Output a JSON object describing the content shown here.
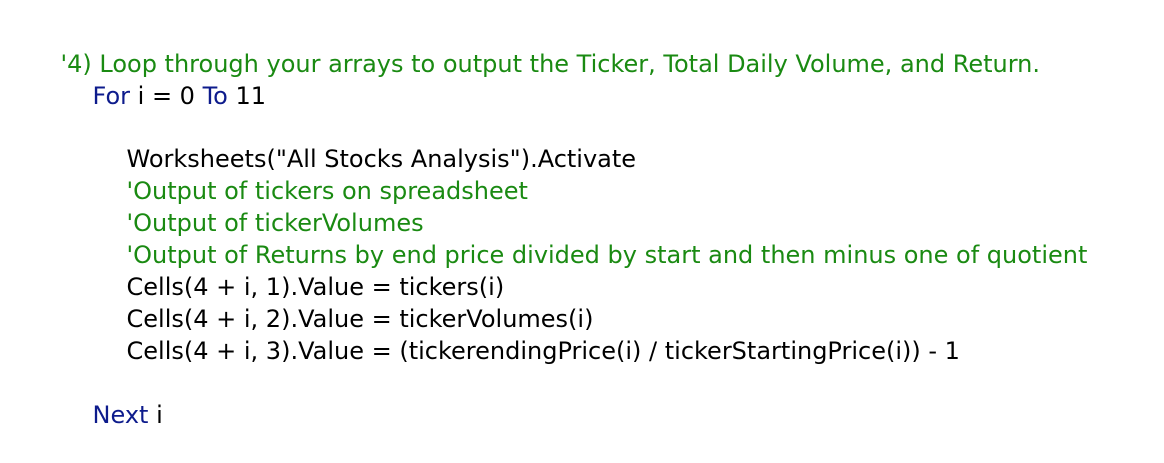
{
  "colors": {
    "comment": "#1a8a12",
    "keyword": "#0d1b8c",
    "text": "#000000",
    "background": "#ffffff"
  },
  "code": {
    "line1": {
      "comment": "'4) Loop through your arrays to output the Ticker, Total Daily Volume, and Return."
    },
    "line2": {
      "kw_for": "For",
      "mid": " i = 0 ",
      "kw_to": "To",
      "end": " 11"
    },
    "line3": {
      "text": "Worksheets(\"All Stocks Analysis\").Activate"
    },
    "line4": {
      "comment": "'Output of tickers on spreadsheet"
    },
    "line5": {
      "comment": "'Output of tickerVolumes"
    },
    "line6": {
      "comment": "'Output of Returns by end price divided by start and then minus one of quotient"
    },
    "line7": {
      "text": "Cells(4 + i, 1).Value = tickers(i)"
    },
    "line8": {
      "text": "Cells(4 + i, 2).Value = tickerVolumes(i)"
    },
    "line9": {
      "text": "Cells(4 + i, 3).Value = (tickerendingPrice(i) / tickerStartingPrice(i)) - 1"
    },
    "line10": {
      "kw_next": "Next",
      "end": " i"
    }
  }
}
